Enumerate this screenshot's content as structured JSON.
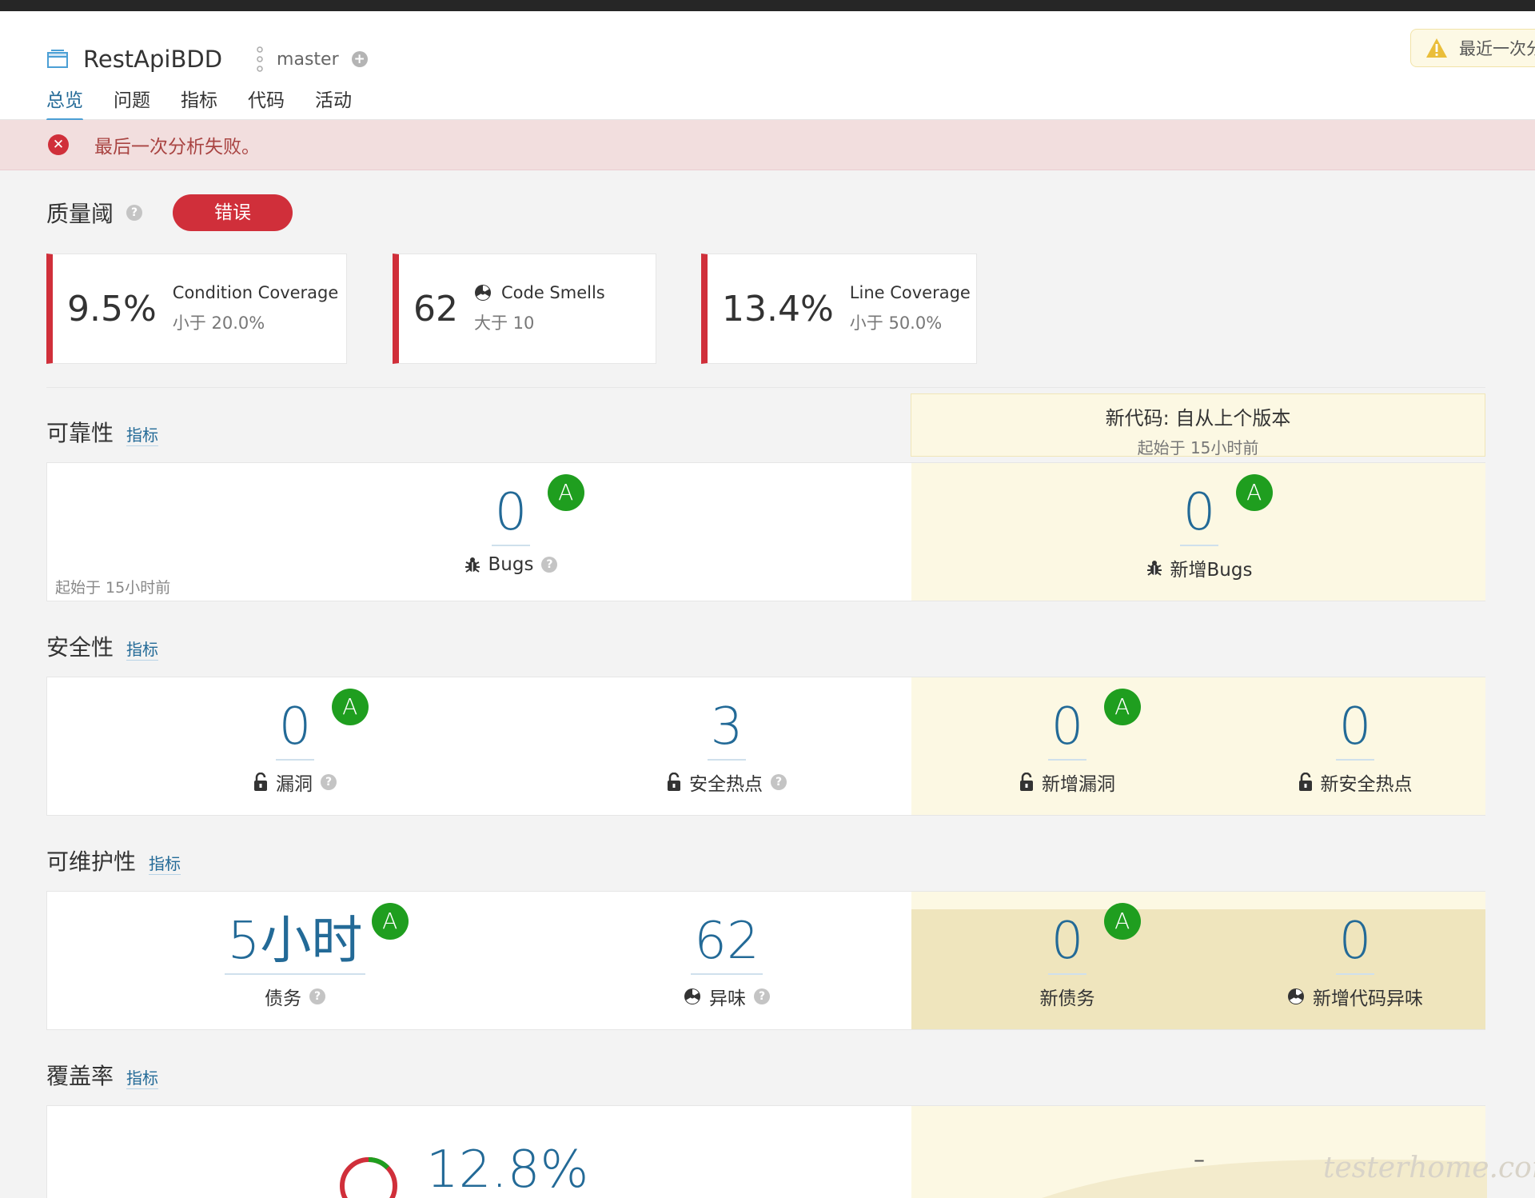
{
  "project": {
    "name": "RestApiBDD",
    "branch": "master"
  },
  "warning": {
    "text": "最近一次分析"
  },
  "tabs": [
    {
      "label": "总览"
    },
    {
      "label": "问题"
    },
    {
      "label": "指标"
    },
    {
      "label": "代码"
    },
    {
      "label": "活动"
    }
  ],
  "alert": {
    "text": "最后一次分析失败。"
  },
  "quality_gate": {
    "title": "质量阈",
    "status": "错误"
  },
  "conditions": [
    {
      "value": "9.5%",
      "name": "Condition Coverage",
      "threshold": "小于 20.0%"
    },
    {
      "value": "62",
      "name": "Code Smells",
      "threshold": "大于 10"
    },
    {
      "value": "13.4%",
      "name": "Line Coverage",
      "threshold": "小于 50.0%"
    }
  ],
  "new_code": {
    "title": "新代码: 自从上个版本",
    "since": "起始于 15小时前"
  },
  "reliability": {
    "title": "可靠性",
    "link": "指标",
    "since": "起始于 15小时前",
    "bugs": {
      "value": "0",
      "rating": "A",
      "label": "Bugs"
    },
    "new_bugs": {
      "value": "0",
      "rating": "A",
      "label": "新增Bugs"
    }
  },
  "security": {
    "title": "安全性",
    "link": "指标",
    "vulnerabilities": {
      "value": "0",
      "rating": "A",
      "label": "漏洞"
    },
    "hotspots": {
      "value": "3",
      "label": "安全热点"
    },
    "new_vulnerabilities": {
      "value": "0",
      "rating": "A",
      "label": "新增漏洞"
    },
    "new_hotspots": {
      "value": "0",
      "label": "新安全热点"
    }
  },
  "maintainability": {
    "title": "可维护性",
    "link": "指标",
    "debt": {
      "value": "5小时",
      "rating": "A",
      "label": "债务"
    },
    "smells": {
      "value": "62",
      "label": "异味"
    },
    "new_debt": {
      "value": "0",
      "rating": "A",
      "label": "新债务"
    },
    "new_smells": {
      "value": "0",
      "label": "新增代码异味"
    }
  },
  "coverage": {
    "title": "覆盖率",
    "link": "指标",
    "value": "12.8%",
    "new_value": "–",
    "ratio": 0.128
  },
  "watermark": "testerhome.com",
  "colors": {
    "error": "#d02f3a",
    "rating_a": "#1f9e1f",
    "link": "#236a97",
    "new_code_bg": "#fcf8e3"
  }
}
